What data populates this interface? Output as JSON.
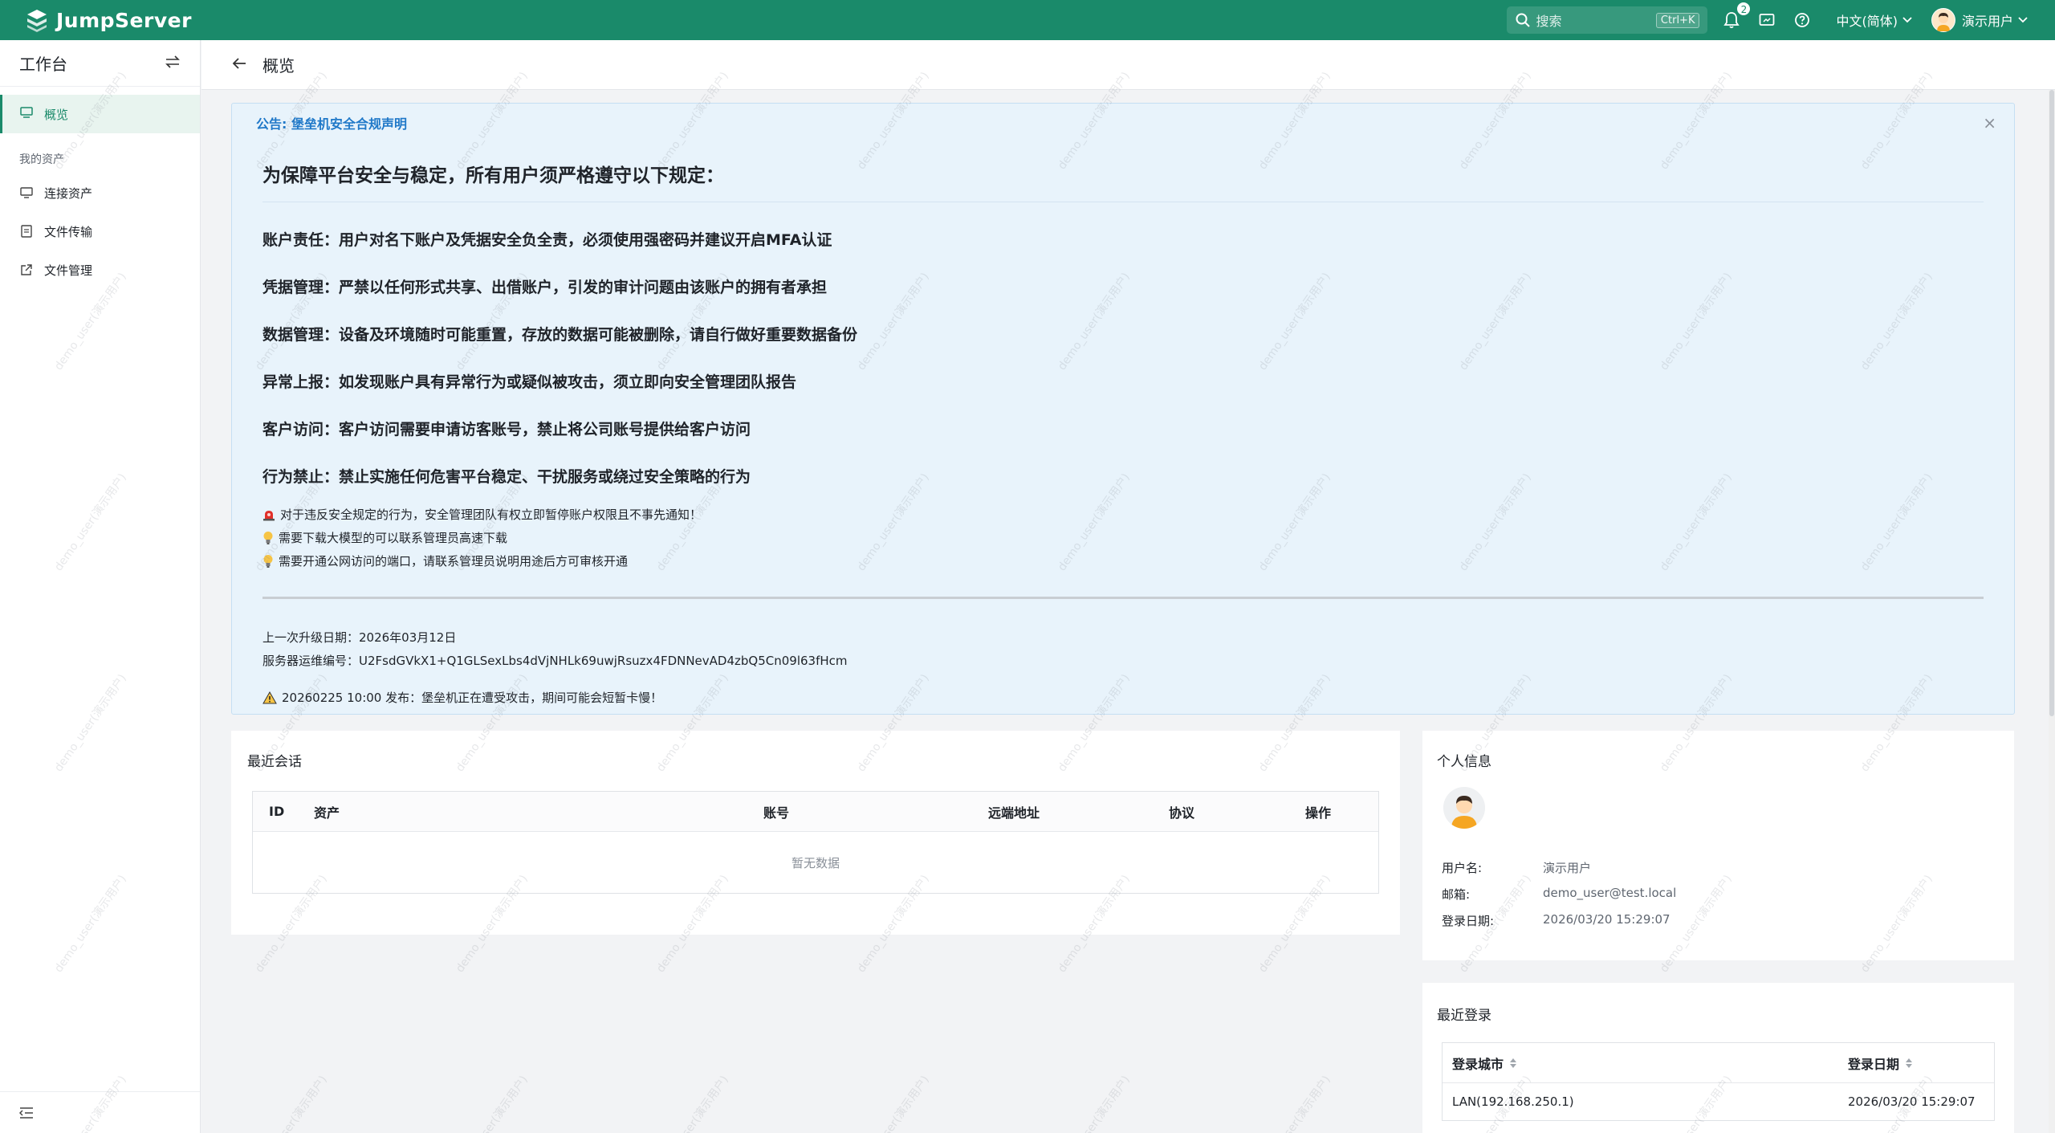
{
  "topbar": {
    "brand": "JumpServer",
    "search_placeholder": "搜索",
    "search_shortcut": "Ctrl+K",
    "notification_count": "2",
    "language": "中文(简体)",
    "username": "演示用户",
    "icons": [
      "search-icon",
      "bell-icon",
      "monitor-icon",
      "help-icon",
      "chevron-down-icon"
    ]
  },
  "sidebar": {
    "title": "工作台",
    "active_item": "概览",
    "group_label": "我的资产",
    "items": [
      {
        "label": "连接资产",
        "icon": "monitor-icon"
      },
      {
        "label": "文件传输",
        "icon": "file-icon"
      },
      {
        "label": "文件管理",
        "icon": "external-link-icon"
      }
    ]
  },
  "page": {
    "title": "概览"
  },
  "announcement": {
    "header": "公告: 堡垒机安全合规声明",
    "title": "为保障平台安全与稳定，所有用户须严格遵守以下规定：",
    "rules": [
      "账户责任：用户对名下账户及凭据安全负全责，必须使用强密码并建议开启MFA认证",
      "凭据管理：严禁以任何形式共享、出借账户，引发的审计问题由该账户的拥有者承担",
      "数据管理：设备及环境随时可能重置，存放的数据可能被删除，请自行做好重要数据备份",
      "异常上报：如发现账户具有异常行为或疑似被攻击，须立即向安全管理团队报告",
      "客户访问：客户访问需要申请访客账号，禁止将公司账号提供给客户访问",
      "行为禁止：禁止实施任何危害平台稳定、干扰服务或绕过安全策略的行为"
    ],
    "notes": [
      {
        "icon": "siren-icon",
        "text": "对于违反安全规定的行为，安全管理团队有权立即暂停账户权限且不事先通知！"
      },
      {
        "icon": "lightbulb-icon",
        "text": "需要下载大模型的可以联系管理员高速下载"
      },
      {
        "icon": "lightbulb-icon",
        "text": "需要开通公网访问的端口，请联系管理员说明用途后方可审核开通"
      }
    ],
    "last_upgrade": "上一次升级日期：2026年03月12日",
    "server_id": "服务器运维编号：U2FsdGVkX1+Q1GLSexLbs4dVjNHLk69uwjRsuzx4FDNNevAD4zbQ5Cn09l63fHcm",
    "warning": "20260225 10:00 发布：堡垒机正在遭受攻击，期间可能会短暂卡慢！"
  },
  "sessions": {
    "title": "最近会话",
    "columns": [
      "ID",
      "资产",
      "账号",
      "远端地址",
      "协议",
      "操作"
    ],
    "empty_text": "暂无数据"
  },
  "profile": {
    "title": "个人信息",
    "fields": [
      {
        "label": "用户名:",
        "value": "演示用户"
      },
      {
        "label": "邮箱:",
        "value": "demo_user@test.local"
      },
      {
        "label": "登录日期:",
        "value": "2026/03/20 15:29:07"
      }
    ]
  },
  "logins": {
    "title": "最近登录",
    "columns": [
      "登录城市",
      "登录日期"
    ],
    "rows": [
      {
        "city": "LAN(192.168.250.1)",
        "date": "2026/03/20 15:29:07"
      }
    ]
  },
  "watermark": "demo_user(演示用户)",
  "colors": {
    "brand": "#1a8a6a",
    "announce_bg": "#e8f3fb",
    "link": "#1f78c8"
  }
}
